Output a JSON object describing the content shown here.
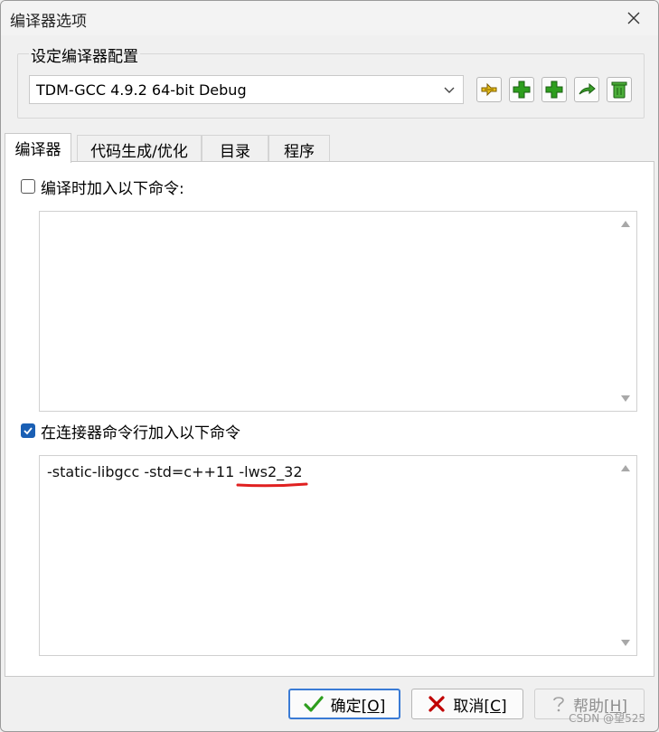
{
  "window": {
    "title": "编译器选项"
  },
  "profile_group": {
    "legend": "设定编译器配置",
    "selected_profile": "TDM-GCC 4.9.2 64-bit Debug"
  },
  "tabs": [
    {
      "label": "编译器",
      "active": true
    },
    {
      "label": "代码生成/优化",
      "active": false
    },
    {
      "label": "目录",
      "active": false
    },
    {
      "label": "程序",
      "active": false
    }
  ],
  "compiler_commands": {
    "checkbox_label": "编译时加入以下命令:",
    "checked": false,
    "text": ""
  },
  "linker_commands": {
    "checkbox_label": "在连接器命令行加入以下命令",
    "checked": true,
    "text": "-static-libgcc -std=c++11 -lws2_32"
  },
  "buttons": {
    "ok_label": "确定",
    "ok_key": "O",
    "cancel_label": "取消",
    "cancel_key": "C",
    "help_label": "帮助",
    "help_key": "H"
  },
  "watermark": "CSDN @望525",
  "icons": {
    "close": "close-icon",
    "dropdown": "chevron-down-icon",
    "tools": [
      "wand-icon",
      "add-icon",
      "add-icon",
      "rename-arrow-icon",
      "trash-icon"
    ],
    "ok": "checkmark-icon",
    "cancel": "x-icon",
    "help": "question-icon"
  },
  "colors": {
    "accent": "#3a7bd5",
    "checkbox_checked": "#1a5fb4",
    "annotation_underline": "#e02020",
    "add_icon_green": "#2e9e1e",
    "cancel_red": "#c00000"
  }
}
